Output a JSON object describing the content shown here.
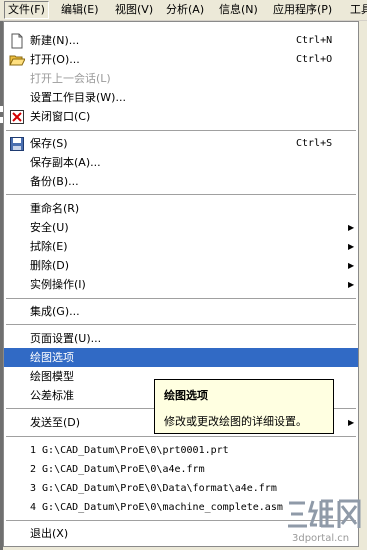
{
  "menubar": {
    "items": [
      {
        "label": "文件(F)"
      },
      {
        "label": "编辑(E)"
      },
      {
        "label": "视图(V)"
      },
      {
        "label": "分析(A)"
      },
      {
        "label": "信息(N)"
      },
      {
        "label": "应用程序(P)"
      },
      {
        "label": "工具"
      }
    ]
  },
  "file_menu": {
    "new": {
      "label": "新建(N)...",
      "shortcut": "Ctrl+N"
    },
    "open": {
      "label": "打开(O)...",
      "shortcut": "Ctrl+O"
    },
    "open_last_session": {
      "label": "打开上一会话(L)"
    },
    "set_working_dir": {
      "label": "设置工作目录(W)..."
    },
    "close_window": {
      "label": "关闭窗口(C)"
    },
    "save": {
      "label": "保存(S)",
      "shortcut": "Ctrl+S"
    },
    "save_copy": {
      "label": "保存副本(A)..."
    },
    "backup": {
      "label": "备份(B)..."
    },
    "rename": {
      "label": "重命名(R)"
    },
    "security": {
      "label": "安全(U)"
    },
    "erase": {
      "label": "拭除(E)"
    },
    "delete": {
      "label": "删除(D)"
    },
    "instance_ops": {
      "label": "实例操作(I)"
    },
    "integrate": {
      "label": "集成(G)..."
    },
    "page_setup": {
      "label": "页面设置(U)..."
    },
    "drawing_options": {
      "label": "绘图选项"
    },
    "drawing_models": {
      "label": "绘图模型"
    },
    "tolerance_standard": {
      "label": "公差标准"
    },
    "send_to": {
      "label": "发送至(D)"
    },
    "recent_files": [
      {
        "label": "1 G:\\CAD_Datum\\ProE\\0\\prt0001.prt"
      },
      {
        "label": "2 G:\\CAD_Datum\\ProE\\0\\a4e.frm"
      },
      {
        "label": "3 G:\\CAD_Datum\\ProE\\0\\Data\\format\\a4e.frm"
      },
      {
        "label": "4 G:\\CAD_Datum\\ProE\\0\\machine_complete.asm"
      }
    ],
    "exit": {
      "label": "退出(X)"
    }
  },
  "tooltip": {
    "title": "绘图选项",
    "body": "修改或更改绘图的详细设置。"
  },
  "watermark": {
    "logo_text": "三维网",
    "url": "3dportal.cn"
  },
  "colors": {
    "highlight": "#316ac5",
    "tooltip_bg": "#ffffe1",
    "close_icon_red": "#d40000"
  }
}
